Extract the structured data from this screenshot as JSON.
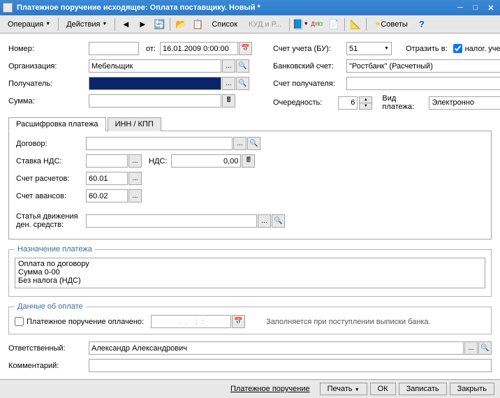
{
  "window": {
    "title": "Платежное поручение исходящее: Оплата поставщику. Новый *"
  },
  "toolbar": {
    "operation": "Операция",
    "actions": "Действия",
    "list": "Список",
    "kudir": "КУД и Р...",
    "advice": "Советы"
  },
  "left": {
    "number_lbl": "Номер:",
    "ot_lbl": "от:",
    "date_val": "16.01.2009 0:00:00",
    "org_lbl": "Организация:",
    "org_val": "Мебельщик",
    "recipient_lbl": "Получатель:",
    "sum_lbl": "Сумма:"
  },
  "right": {
    "account_lbl": "Счет учета (БУ):",
    "account_val": "51",
    "reflect_lbl": "Отразить в:",
    "tax_check_lbl": "налог. учете",
    "bank_lbl": "Банковский счет:",
    "bank_val": "\"Ростбанк\" (Расчетный)",
    "recipient_acc_lbl": "Счет получателя:",
    "order_lbl": "Очередность:",
    "order_val": "6",
    "payment_type_lbl": "Вид платежа:",
    "payment_type_val": "Электронно"
  },
  "tabs": {
    "tab1": "Расшифровка платежа",
    "tab2": "ИНН / КПП",
    "contract_lbl": "Договор:",
    "vat_rate_lbl": "Ставка НДС:",
    "vat_lbl": "НДС:",
    "vat_val": "0,00",
    "calc_acc_lbl": "Счет расчетов:",
    "calc_acc_val": "60.01",
    "advance_acc_lbl": "Счет авансов:",
    "advance_acc_val": "60.02",
    "movement_lbl": "Статья движения ден. средств:"
  },
  "purpose": {
    "legend": "Назначение платежа",
    "text": "Оплата по договору\nСумма 0-00\nБез налога (НДС)"
  },
  "payment": {
    "legend": "Данные об оплате",
    "paid_lbl": "Платежное поручение оплачено:",
    "date_mask": ".  .    :  :",
    "hint": "Заполняется при поступлении выписки банка."
  },
  "bottom": {
    "responsible_lbl": "Ответственный:",
    "responsible_val": "Александр Александрович",
    "comment_lbl": "Комментарий:"
  },
  "footer": {
    "print": "Платежное поручение",
    "pechat": "Печать",
    "ok": "ОК",
    "save": "Записать",
    "close": "Закрыть"
  }
}
